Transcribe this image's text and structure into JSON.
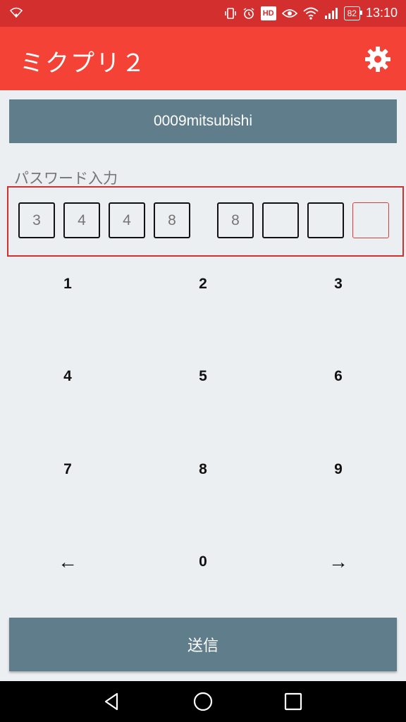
{
  "status_bar": {
    "time": "13:10",
    "battery": "82",
    "hd_label": "HD",
    "icons": [
      "wifi-icon",
      "vibrate-icon",
      "alarm-icon",
      "hd-icon",
      "eye-icon",
      "wifi-icon",
      "signal-icon",
      "battery-icon"
    ]
  },
  "app": {
    "title": "ミクプリ２",
    "settings_icon": "gear-icon"
  },
  "user": {
    "name": "0009mitsubishi"
  },
  "password": {
    "label": "パスワード入力",
    "digits": [
      "3",
      "4",
      "4",
      "8",
      "8",
      "",
      "",
      ""
    ]
  },
  "keypad": {
    "keys": [
      "1",
      "2",
      "3",
      "4",
      "5",
      "6",
      "7",
      "8",
      "9",
      "←",
      "0",
      "→"
    ]
  },
  "submit_label": "送信",
  "colors": {
    "status_bar": "#d32f2f",
    "app_bar": "#f44336",
    "accent_gray": "#607d8b",
    "background": "#eceff1",
    "highlight": "#d32f2f"
  }
}
